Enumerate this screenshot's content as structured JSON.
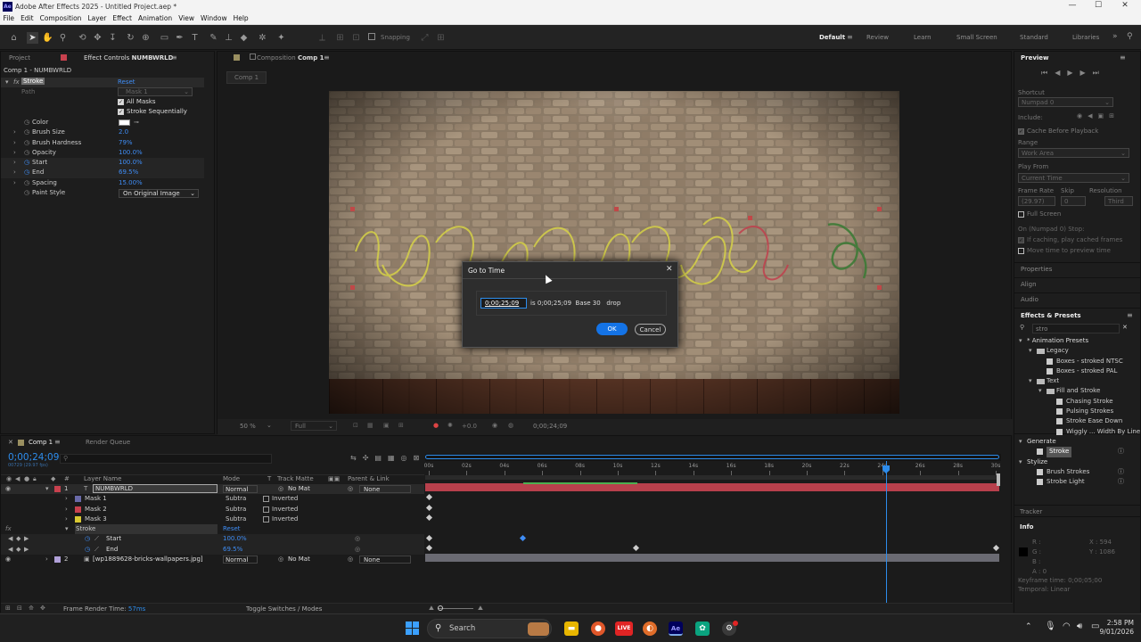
{
  "app": {
    "title": "Adobe After Effects 2025 - Untitled Project.aep *",
    "icon_text": "Ae"
  },
  "window_controls": {
    "minimize": "—",
    "maximize": "☐",
    "close": "✕"
  },
  "menu": [
    "File",
    "Edit",
    "Composition",
    "Layer",
    "Effect",
    "Animation",
    "View",
    "Window",
    "Help"
  ],
  "toolbar": {
    "snapping_label": "Snapping"
  },
  "workspaces": [
    {
      "label": "Default",
      "active": true
    },
    {
      "label": "Review"
    },
    {
      "label": "Learn"
    },
    {
      "label": "Small Screen"
    },
    {
      "label": "Standard"
    },
    {
      "label": "Libraries"
    }
  ],
  "left_panel": {
    "tab_project": "Project",
    "tab_effect_controls_prefix": "Effect Controls",
    "tab_effect_controls_layer": "NUMBWRLD",
    "header": "Comp 1 - NUMBWRLD",
    "effect_name": "Stroke",
    "reset": "Reset",
    "path_label": "Path",
    "path_value": "Mask 1",
    "all_masks": "All Masks",
    "stroke_sequentially": "Stroke Sequentially",
    "props": [
      {
        "name": "Color",
        "value": ""
      },
      {
        "name": "Brush Size",
        "value": "2.0"
      },
      {
        "name": "Brush Hardness",
        "value": "79%"
      },
      {
        "name": "Opacity",
        "value": "100.0%"
      },
      {
        "name": "Start",
        "value": "100.0%"
      },
      {
        "name": "End",
        "value": "69.5%"
      },
      {
        "name": "Spacing",
        "value": "15.00%"
      }
    ],
    "paint_style_label": "Paint Style",
    "paint_style_value": "On Original Image"
  },
  "comp_panel": {
    "tab_label": "Composition",
    "tab_comp": "Comp 1",
    "breadcrumb": "Comp 1",
    "zoom": "50 %",
    "resolution": "Full",
    "exposure": "+0.0",
    "timecode": "0;00;24;09"
  },
  "dialog": {
    "title": "Go to Time",
    "input_value": "0;00;25;09",
    "info": "is 0;00;25;09  Base 30   drop",
    "ok": "OK",
    "cancel": "Cancel"
  },
  "preview": {
    "title": "Preview",
    "shortcut_label": "Shortcut",
    "shortcut_value": "Numpad 0",
    "include_label": "Include:",
    "cache_before": "Cache Before Playback",
    "range_label": "Range",
    "range_value": "Work Area",
    "play_from_label": "Play From",
    "play_from_value": "Current Time",
    "frame_rate_label": "Frame Rate",
    "skip_label": "Skip",
    "resolution_label": "Resolution",
    "frame_rate_value": "(29.97)",
    "skip_value": "0",
    "resolution_value": "Third",
    "full_screen": "Full Screen",
    "on_stop": "On (Numpad 0) Stop:",
    "if_caching": "If caching, play cached frames",
    "move_time": "Move time to preview time"
  },
  "right_sections": [
    "Properties",
    "Align",
    "Audio"
  ],
  "effects_presets": {
    "title": "Effects & Presets",
    "search_value": "stro",
    "tree": [
      {
        "label": "* Animation Presets",
        "level": 0,
        "type": "group"
      },
      {
        "label": "Legacy",
        "level": 1,
        "type": "folder"
      },
      {
        "label": "Boxes - stroked NTSC",
        "level": 2,
        "type": "item"
      },
      {
        "label": "Boxes - stroked PAL",
        "level": 2,
        "type": "item"
      },
      {
        "label": "Text",
        "level": 1,
        "type": "folder"
      },
      {
        "label": "Fill and Stroke",
        "level": 2,
        "type": "folder"
      },
      {
        "label": "Chasing Stroke",
        "level": 3,
        "type": "item"
      },
      {
        "label": "Pulsing Strokes",
        "level": 3,
        "type": "item"
      },
      {
        "label": "Stroke Ease Down",
        "level": 3,
        "type": "item"
      },
      {
        "label": "Wiggly ... Width By Line",
        "level": 3,
        "type": "item"
      },
      {
        "label": "Generate",
        "level": 0,
        "type": "group"
      },
      {
        "label": "Stroke",
        "level": 1,
        "type": "item",
        "selected": true
      },
      {
        "label": "Stylize",
        "level": 0,
        "type": "group"
      },
      {
        "label": "Brush Strokes",
        "level": 1,
        "type": "item"
      },
      {
        "label": "Strobe Light",
        "level": 1,
        "type": "item"
      }
    ]
  },
  "tracker": {
    "title": "Tracker"
  },
  "info": {
    "title": "Info",
    "r": "R :",
    "g": "G :",
    "b": "B :",
    "a": "A :  0",
    "x": "X : 594",
    "y": "Y : 1086",
    "keyframe_time": "Keyframe time: 0;00;05;00",
    "temporal": "Temporal: Linear"
  },
  "timeline": {
    "tab_comp": "Comp 1",
    "tab_render": "Render Queue",
    "current_time": "0;00;24;09",
    "fps_info": "00729 (29.97 fps)",
    "headers": {
      "num": "#",
      "layer_name": "Layer Name",
      "mode": "Mode",
      "t": "T",
      "track_matte": "Track Matte",
      "parent": "Parent & Link"
    },
    "ruler": [
      "00s",
      "02s",
      "04s",
      "06s",
      "08s",
      "10s",
      "12s",
      "14s",
      "16s",
      "18s",
      "20s",
      "22s",
      "24s",
      "26s",
      "28s",
      "30s"
    ],
    "layers": [
      {
        "num": "1",
        "name": "NUMBWRLD",
        "mode": "Normal",
        "matte": "No Mat",
        "parent": "None",
        "color": "#c8414e"
      },
      {
        "num": "2",
        "name": "[wp1889628-bricks-wallpapers.jpg]",
        "mode": "Normal",
        "matte": "No Mat",
        "parent": "None",
        "color": "#b0a0d8"
      }
    ],
    "masks": [
      {
        "name": "Mask 1",
        "mode": "Subtra",
        "inv": "Inverted",
        "color": "#6a6aa8"
      },
      {
        "name": "Mask 2",
        "mode": "Subtra",
        "inv": "Inverted",
        "color": "#c8414e"
      },
      {
        "name": "Mask 3",
        "mode": "Subtra",
        "inv": "Inverted",
        "color": "#d8c832"
      }
    ],
    "stroke_label": "Stroke",
    "stroke_reset": "Reset",
    "start_label": "Start",
    "start_value": "100.0%",
    "end_label": "End",
    "end_value": "69.5%",
    "frame_render_label": "Frame Render Time:",
    "frame_render_value": "57ms",
    "toggle_label": "Toggle Switches / Modes",
    "fx_label": "fx"
  },
  "taskbar": {
    "search": "Search",
    "time": "2:58 PM",
    "date": "9/01/2026",
    "live_label": "LIVE"
  },
  "colors": {
    "accent": "#2d8ceb",
    "layer_bar": "#c04450",
    "selection_blue": "#1473e6"
  }
}
